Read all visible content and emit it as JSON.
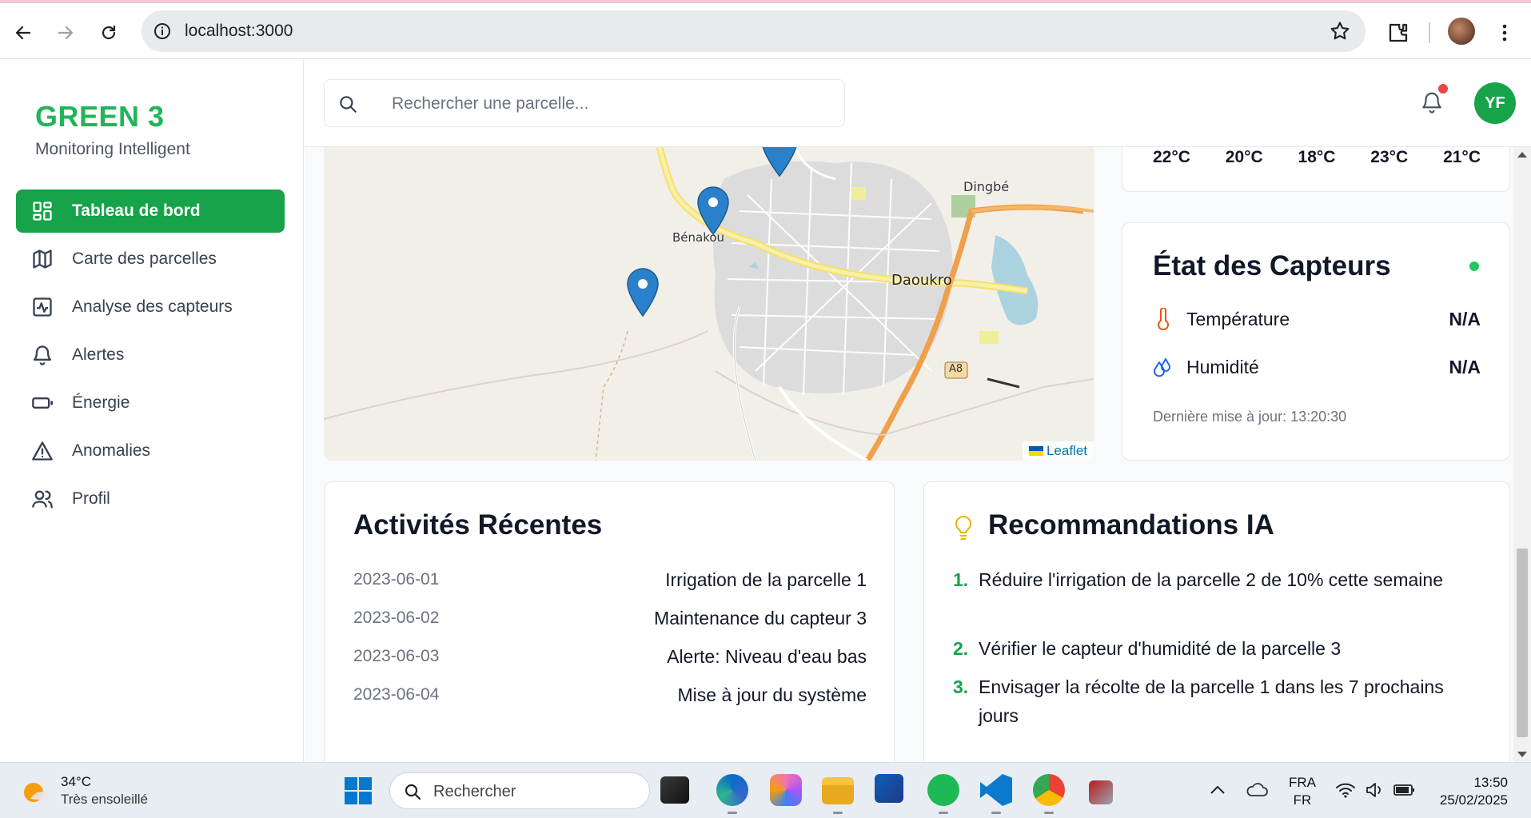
{
  "browser": {
    "url": "localhost:3000"
  },
  "app": {
    "logo_title": "GREEN 3",
    "logo_subtitle": "Monitoring Intelligent",
    "menu": [
      {
        "label": "Tableau de bord",
        "icon": "dashboard-icon",
        "active": true
      },
      {
        "label": "Carte des parcelles",
        "icon": "map-icon",
        "active": false
      },
      {
        "label": "Analyse des capteurs",
        "icon": "activity-icon",
        "active": false
      },
      {
        "label": "Alertes",
        "icon": "bell-icon",
        "active": false
      },
      {
        "label": "Énergie",
        "icon": "battery-icon",
        "active": false
      },
      {
        "label": "Anomalies",
        "icon": "warning-icon",
        "active": false
      },
      {
        "label": "Profil",
        "icon": "users-icon",
        "active": false
      }
    ],
    "accent_color": "#16a34a"
  },
  "header": {
    "search_placeholder": "Rechercher une parcelle...",
    "avatar_initials": "YF",
    "has_notification": true
  },
  "map": {
    "labels": [
      "Dingbé",
      "Bénakou",
      "Daoukro",
      "A8"
    ],
    "attribution": "Leaflet",
    "markers": 3
  },
  "weather_forecast": {
    "temps": [
      "22°C",
      "20°C",
      "18°C",
      "23°C",
      "21°C"
    ]
  },
  "sensors": {
    "title": "État des Capteurs",
    "status": "online",
    "rows": [
      {
        "label": "Température",
        "value": "N/A",
        "icon": "thermometer-icon"
      },
      {
        "label": "Humidité",
        "value": "N/A",
        "icon": "droplets-icon"
      }
    ],
    "last_update": "Dernière mise à jour: 13:20:30"
  },
  "activities": {
    "title": "Activités Récentes",
    "items": [
      {
        "date": "2023-06-01",
        "desc": "Irrigation de la parcelle 1"
      },
      {
        "date": "2023-06-02",
        "desc": "Maintenance du capteur 3"
      },
      {
        "date": "2023-06-03",
        "desc": "Alerte: Niveau d'eau bas"
      },
      {
        "date": "2023-06-04",
        "desc": "Mise à jour du système"
      }
    ]
  },
  "recommendations": {
    "title": "Recommandations IA",
    "items": [
      {
        "num": "1.",
        "text": "Réduire l'irrigation de la parcelle 2 de 10% cette semaine"
      },
      {
        "num": "2.",
        "text": "Vérifier le capteur d'humidité de la parcelle 3"
      },
      {
        "num": "3.",
        "text": "Envisager la récolte de la parcelle 1 dans les 7 prochains jours"
      }
    ]
  },
  "taskbar": {
    "weather_temp": "34°C",
    "weather_desc": "Très ensoleillé",
    "search_label": "Rechercher",
    "lang_line1": "FRA",
    "lang_line2": "FR",
    "time": "13:50",
    "date": "25/02/2025"
  }
}
